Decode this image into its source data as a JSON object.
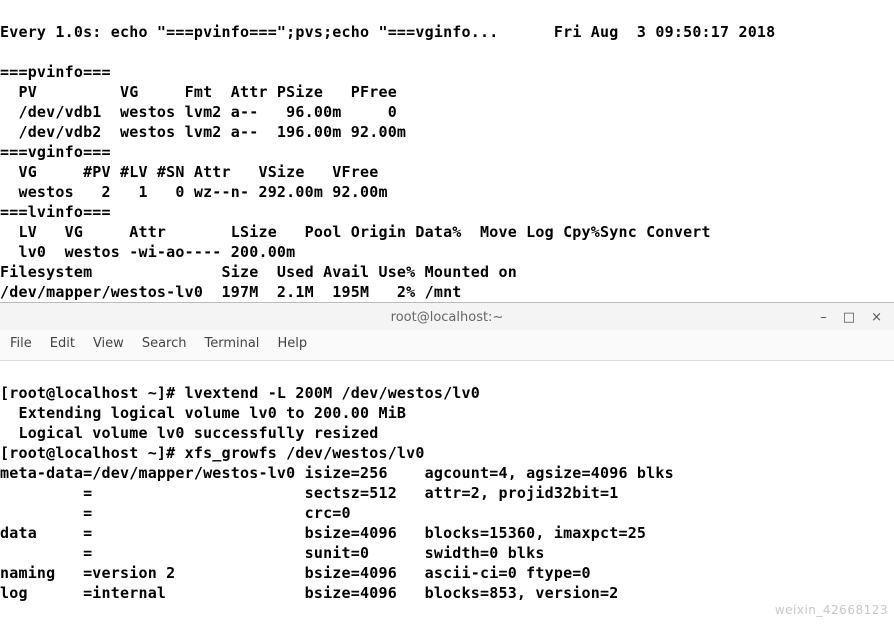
{
  "watch": {
    "header_left": "Every 1.0s: echo \"===pvinfo===\";pvs;echo \"===vginfo...",
    "header_right": "Fri Aug  3 09:50:17 2018",
    "section_pv": "===pvinfo===",
    "pv_header": "  PV         VG     Fmt  Attr PSize   PFree",
    "pv_rows": [
      "  /dev/vdb1  westos lvm2 a--   96.00m     0",
      "  /dev/vdb2  westos lvm2 a--  196.00m 92.00m"
    ],
    "section_vg": "===vginfo===",
    "vg_header": "  VG     #PV #LV #SN Attr   VSize   VFree",
    "vg_rows": [
      "  westos   2   1   0 wz--n- 292.00m 92.00m"
    ],
    "section_lv": "===lvinfo===",
    "lv_header": "  LV   VG     Attr       LSize   Pool Origin Data%  Move Log Cpy%Sync Convert",
    "lv_rows": [
      "  lv0  westos -wi-ao---- 200.00m"
    ],
    "fs_header": "Filesystem              Size  Used Avail Use% Mounted on",
    "fs_rows": [
      "/dev/mapper/westos-lv0  197M  2.1M  195M   2% /mnt"
    ]
  },
  "window": {
    "title": "root@localhost:~",
    "btn_min": "–",
    "btn_max": "□",
    "btn_close": "×"
  },
  "menu": {
    "file": "File",
    "edit": "Edit",
    "view": "View",
    "search": "Search",
    "terminal": "Terminal",
    "help": "Help"
  },
  "term": {
    "line1": "[root@localhost ~]# lvextend -L 200M /dev/westos/lv0",
    "line2": "  Extending logical volume lv0 to 200.00 MiB",
    "line3": "  Logical volume lv0 successfully resized",
    "line4": "[root@localhost ~]# xfs_growfs /dev/westos/lv0",
    "line5": "meta-data=/dev/mapper/westos-lv0 isize=256    agcount=4, agsize=4096 blks",
    "line6": "         =                       sectsz=512   attr=2, projid32bit=1",
    "line7": "         =                       crc=0",
    "line8": "data     =                       bsize=4096   blocks=15360, imaxpct=25",
    "line9": "         =                       sunit=0      swidth=0 blks",
    "line10": "naming   =version 2              bsize=4096   ascii-ci=0 ftype=0",
    "line11": "log      =internal               bsize=4096   blocks=853, version=2"
  },
  "watermark": "weixin_42668123"
}
